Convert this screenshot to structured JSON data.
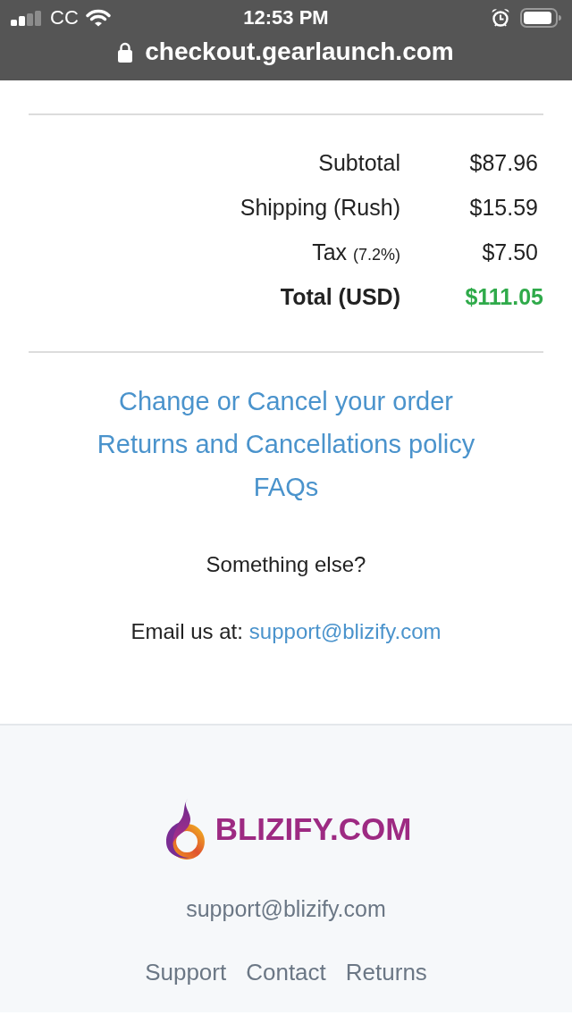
{
  "status_bar": {
    "carrier": "CC",
    "time": "12:53 PM"
  },
  "address_bar": {
    "url": "checkout.gearlaunch.com"
  },
  "totals": [
    {
      "kind": "line",
      "label": "Subtotal",
      "value": "$87.96"
    },
    {
      "kind": "line",
      "label": "Shipping (Rush)",
      "value": "$15.59"
    },
    {
      "kind": "line",
      "label": "Tax",
      "note": "(7.2%)",
      "value": "$7.50"
    },
    {
      "kind": "total",
      "label": "Total (USD)",
      "value": "$111.05"
    }
  ],
  "help_links": [
    "Change or Cancel your order",
    "Returns and Cancellations policy",
    "FAQs"
  ],
  "contact": {
    "question": "Something else?",
    "email_prefix": "Email us at:",
    "email": "support@blizify.com"
  },
  "footer": {
    "logo_text": "BLIZIFY.COM",
    "email": "support@blizify.com",
    "links": [
      "Support",
      "Contact",
      "Returns"
    ]
  }
}
